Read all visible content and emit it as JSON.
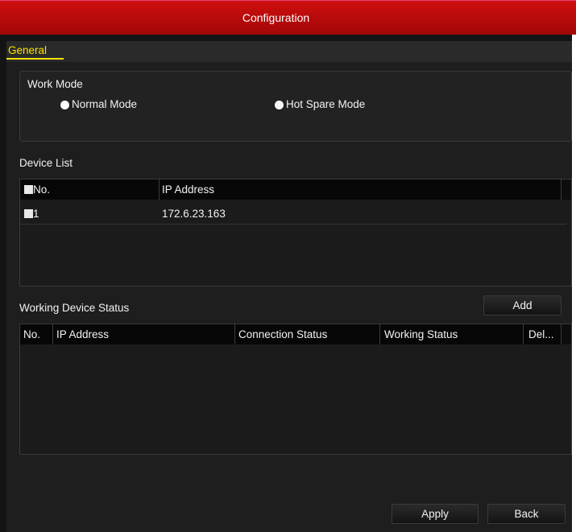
{
  "window": {
    "title": "Configuration"
  },
  "tabs": [
    {
      "label": "General",
      "active": true
    }
  ],
  "work_mode": {
    "label": "Work Mode",
    "options": [
      {
        "label": "Normal Mode",
        "selected": false
      },
      {
        "label": "Hot Spare Mode",
        "selected": true
      }
    ]
  },
  "device_list": {
    "label": "Device List",
    "columns": [
      "No.",
      "IP Address"
    ],
    "rows": [
      {
        "no": "1",
        "ip": "172.6.23.163"
      }
    ]
  },
  "working_status": {
    "label": "Working Device Status",
    "add_label": "Add",
    "columns": [
      "No.",
      "IP Address",
      "Connection Status",
      "Working Status",
      "Del..."
    ],
    "rows": []
  },
  "footer": {
    "apply_label": "Apply",
    "back_label": "Back"
  },
  "colors": {
    "title_bar": "#c00d0d",
    "tab_active": "#ffe200",
    "background": "#1e1e1e"
  }
}
